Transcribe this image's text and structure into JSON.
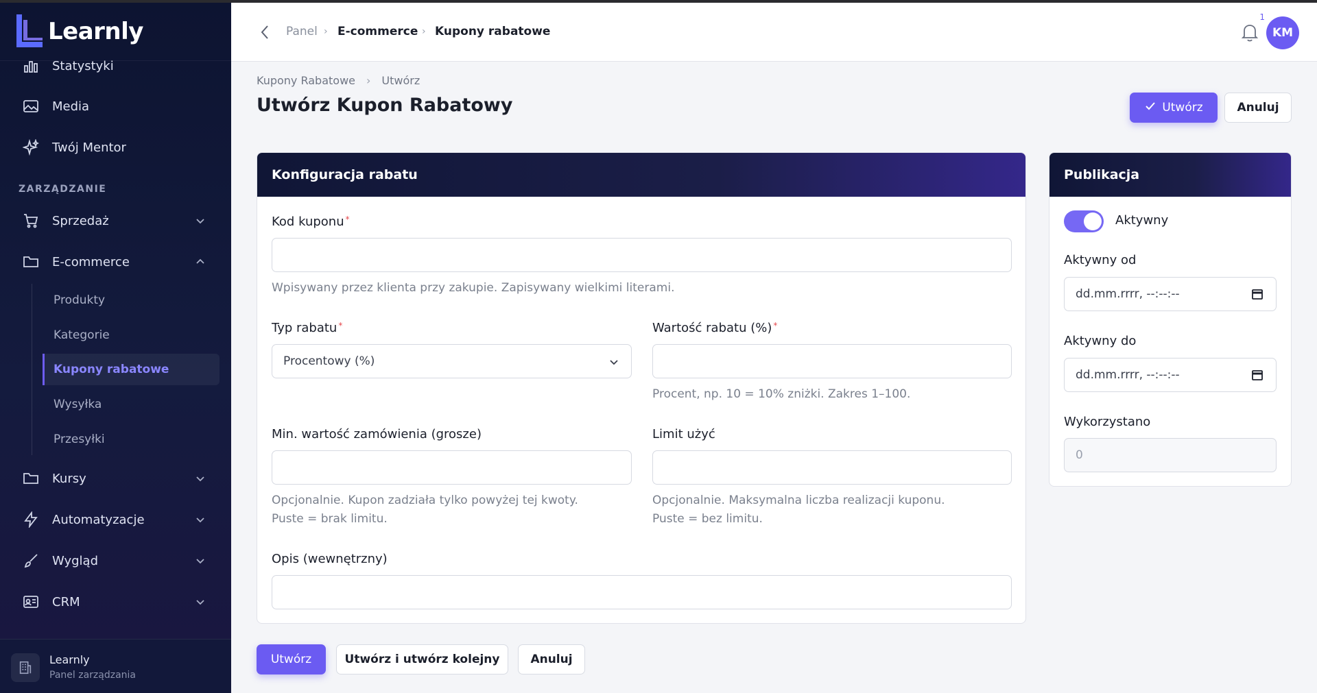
{
  "brand": {
    "name": "Learnly"
  },
  "sidebar": {
    "items_top": [
      {
        "label": "Statystyki",
        "icon": "bar-chart-icon"
      },
      {
        "label": "Media",
        "icon": "image-icon"
      },
      {
        "label": "Twój Mentor",
        "icon": "sparkles-icon"
      }
    ],
    "section_label": "ZARZĄDZANIE",
    "sprzedaz": "Sprzedaż",
    "ecommerce": "E-commerce",
    "ecommerce_sub": [
      "Produkty",
      "Kategorie",
      "Kupony rabatowe",
      "Wysyłka",
      "Przesyłki"
    ],
    "kursy": "Kursy",
    "automatyzacje": "Automatyzacje",
    "wyglad": "Wygląd",
    "crm": "CRM",
    "footer": {
      "name": "Learnly",
      "subtitle": "Panel zarządzania"
    }
  },
  "topbar": {
    "breadcrumb": [
      "Panel",
      "E-commerce",
      "Kupony rabatowe"
    ],
    "notifications_count": "1",
    "avatar_initials": "KM"
  },
  "page": {
    "breadcrumb": [
      "Kupony Rabatowe",
      "Utwórz"
    ],
    "title": "Utwórz Kupon Rabatowy",
    "create_label": "Utwórz",
    "cancel_label": "Anuluj"
  },
  "config_card": {
    "title": "Konfiguracja rabatu",
    "code_label": "Kod kuponu",
    "code_value": "",
    "code_hint": "Wpisywany przez klienta przy zakupie. Zapisywany wielkimi literami.",
    "type_label": "Typ rabatu",
    "type_value": "Procentowy (%)",
    "value_label": "Wartość rabatu (%)",
    "value_value": "",
    "value_hint": "Procent, np. 10 = 10% zniżki. Zakres 1–100.",
    "min_label": "Min. wartość zamówienia (grosze)",
    "min_value": "",
    "min_hint_1": "Opcjonalnie. Kupon zadziała tylko powyżej tej kwoty.",
    "min_hint_2": "Puste = brak limitu.",
    "limit_label": "Limit użyć",
    "limit_value": "",
    "limit_hint_1": "Opcjonalnie. Maksymalna liczba realizacji kuponu.",
    "limit_hint_2": "Puste = bez limitu.",
    "desc_label": "Opis (wewnętrzny)",
    "desc_value": "",
    "required_mark": "*"
  },
  "publish_card": {
    "title": "Publikacja",
    "active_label": "Aktywny",
    "active_on": true,
    "from_label": "Aktywny od",
    "from_value": "dd.mm.rrrr, --:--:--",
    "to_label": "Aktywny do",
    "to_value": "dd.mm.rrrr, --:--:--",
    "used_label": "Wykorzystano",
    "used_value": "0"
  },
  "bottom_actions": {
    "create": "Utwórz",
    "create_another": "Utwórz i utwórz kolejny",
    "cancel": "Anuluj"
  },
  "colors": {
    "accent": "#6b5bf2",
    "sidebar_bg": "#0d1431",
    "required": "#e5484d"
  }
}
